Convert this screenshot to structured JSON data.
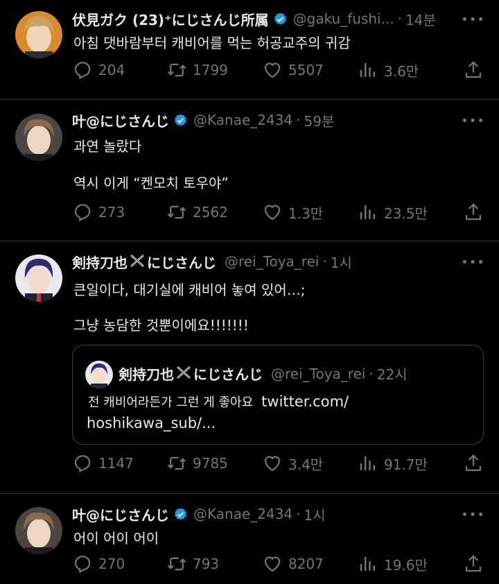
{
  "tweets": [
    {
      "name": "伏見ガク (23)⁺にじさんじ所属",
      "handle": "@gaku_fushi...",
      "separator": "·",
      "time": "14분",
      "lines": [
        "아침 댓바람부터 캐비어를 먹는 허공교주의 귀감"
      ],
      "replies": "204",
      "retweets": "1799",
      "likes": "5507",
      "views": "3.6만"
    },
    {
      "name": "叶@にじさんじ",
      "handle": "@Kanae_2434",
      "separator": "·",
      "time": "59분",
      "lines": [
        "과연 놀랐다",
        "역시 이게 “켄모치 토우야”"
      ],
      "replies": "273",
      "retweets": "2562",
      "likes": "1.3만",
      "views": "23.5만"
    },
    {
      "name_part1": "剣持刀也",
      "name_part2": "にじさんじ",
      "handle": "@rei_Toya_rei",
      "separator": "·",
      "time": "1시",
      "lines": [
        "큰일이다, 대기실에 캐비어 놓여 있어…;",
        "그냥 농담한 것뿐이에요!!!!!!!"
      ],
      "quote": {
        "name_part1": "剣持刀也",
        "name_part2": "にじさんじ",
        "handle": "@rei_Toya_rei",
        "separator": "·",
        "time": "22시",
        "text": "전 캐비어라든가 그런 게 좋아요",
        "link_part1": "twitter.com/",
        "link_part2": "hoshikawa_sub/..."
      },
      "replies": "1147",
      "retweets": "9785",
      "likes": "3.4만",
      "views": "91.7만"
    },
    {
      "name": "叶@にじさんじ",
      "handle": "@Kanae_2434",
      "separator": "·",
      "time": "1시",
      "lines": [
        "어이 어이 어이"
      ],
      "replies": "270",
      "retweets": "793",
      "likes": "8207",
      "views": "19.6만"
    }
  ],
  "more_label": "•••",
  "colors": {
    "background": "#000000",
    "text": "#e7e9ea",
    "muted": "#71767b",
    "verified": "#1d9bf0",
    "divider": "#2f3336"
  },
  "icons": [
    "reply-icon",
    "retweet-icon",
    "like-icon",
    "views-icon",
    "share-icon",
    "verified-badge-icon",
    "more-icon"
  ]
}
